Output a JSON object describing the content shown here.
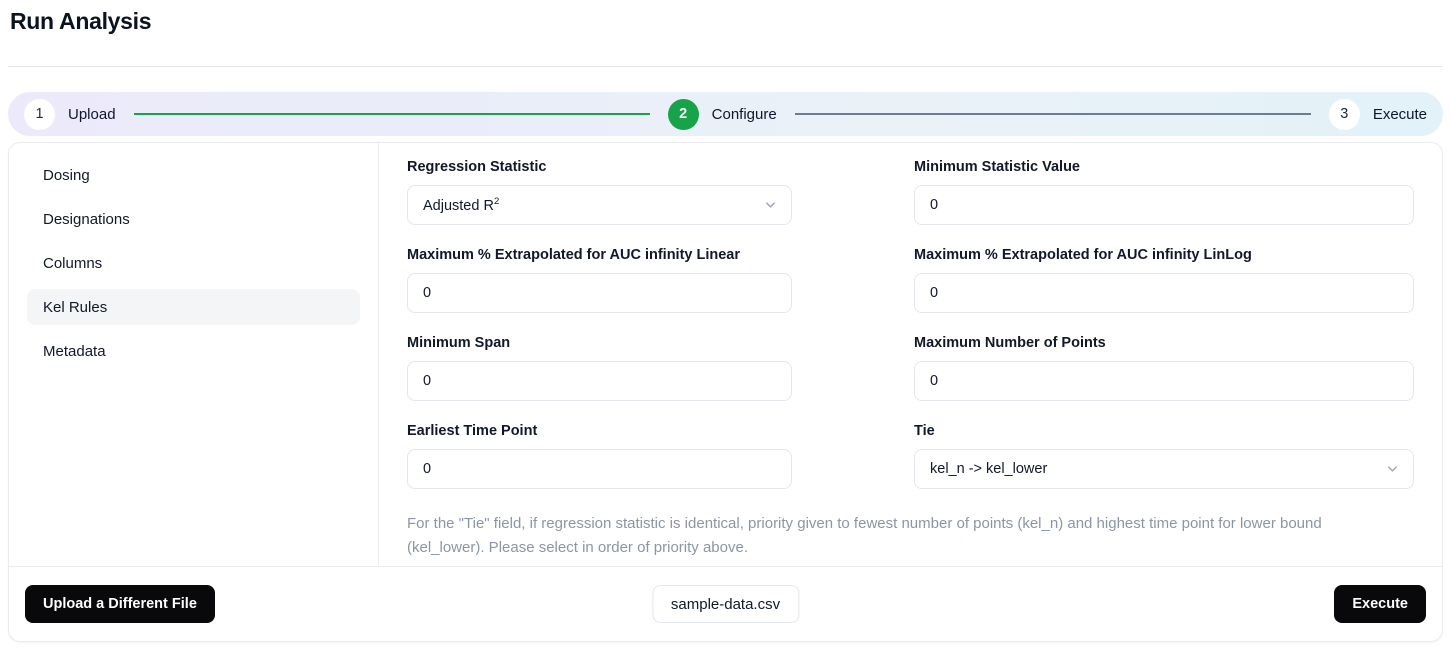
{
  "header": {
    "title": "Run Analysis"
  },
  "stepper": {
    "steps": [
      {
        "num": "1",
        "label": "Upload",
        "state": "done"
      },
      {
        "num": "2",
        "label": "Configure",
        "state": "active"
      },
      {
        "num": "3",
        "label": "Execute",
        "state": "todo"
      }
    ],
    "colors": {
      "done": "#16a34a",
      "todo": "#6b7c93",
      "active_circle": "#16a34a"
    }
  },
  "sidebar": {
    "items": [
      {
        "label": "Dosing",
        "selected": false
      },
      {
        "label": "Designations",
        "selected": false
      },
      {
        "label": "Columns",
        "selected": false
      },
      {
        "label": "Kel Rules",
        "selected": true
      },
      {
        "label": "Metadata",
        "selected": false
      }
    ]
  },
  "form": {
    "regression_statistic": {
      "label": "Regression Statistic",
      "value": "Adjusted R",
      "value_sup": "2",
      "type": "select"
    },
    "minimum_statistic_value": {
      "label": "Minimum Statistic Value",
      "value": "0",
      "type": "text"
    },
    "max_extrap_linear": {
      "label": "Maximum % Extrapolated for AUC infinity Linear",
      "value": "0",
      "type": "text"
    },
    "max_extrap_linlog": {
      "label": "Maximum % Extrapolated for AUC infinity LinLog",
      "value": "0",
      "type": "text"
    },
    "minimum_span": {
      "label": "Minimum Span",
      "value": "0",
      "type": "text"
    },
    "maximum_number_of_points": {
      "label": "Maximum Number of Points",
      "value": "0",
      "type": "text"
    },
    "earliest_time_point": {
      "label": "Earliest Time Point",
      "value": "0",
      "type": "text"
    },
    "tie": {
      "label": "Tie",
      "value": "kel_n -> kel_lower",
      "type": "select"
    },
    "help_text": "For the \"Tie\" field, if regression statistic is identical, priority given to fewest number of points (kel_n) and highest time point for lower bound (kel_lower). Please select in order of priority above."
  },
  "footer": {
    "upload_different_file": "Upload a Different File",
    "file_name": "sample-data.csv",
    "execute": "Execute"
  },
  "icons": {
    "chevron_down": "chevron-down-icon"
  }
}
